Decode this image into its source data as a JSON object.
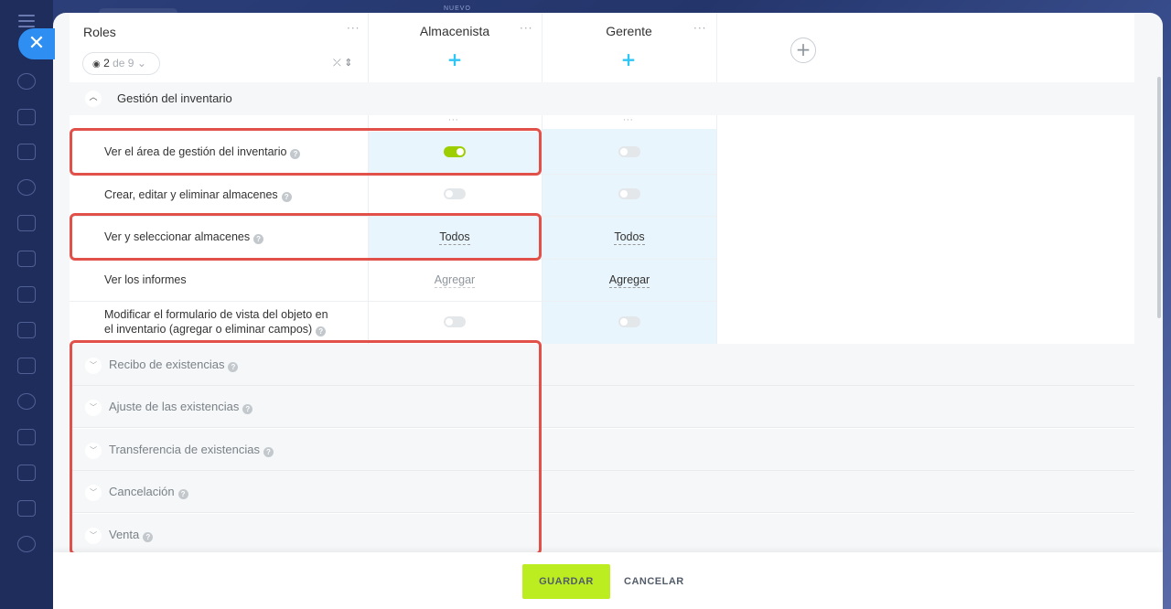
{
  "top": {
    "new_label": "NUEVO"
  },
  "header": {
    "roles_title": "Roles",
    "filter": {
      "shown": "2",
      "of_label": "de 9"
    },
    "columns": [
      {
        "title": "Almacenista"
      },
      {
        "title": "Gerente"
      }
    ]
  },
  "section": {
    "title": "Gestión del inventario"
  },
  "rows": [
    {
      "label": "Ver el área de gestión del inventario",
      "almacenista": "on",
      "gerente": "off"
    },
    {
      "label": "Crear, editar y eliminar almacenes",
      "almacenista": "off",
      "gerente": "off"
    },
    {
      "label": "Ver y seleccionar almacenes",
      "almacenista": "Todos",
      "gerente": "Todos"
    },
    {
      "label": "Ver los informes",
      "almacenista": "Agregar",
      "gerente": "Agregar"
    },
    {
      "label_line1": "Modificar el formulario de vista del objeto en",
      "label_line2": "el inventario (agregar o eliminar campos)",
      "almacenista": "off",
      "gerente": "off"
    }
  ],
  "collapsed_sections": [
    {
      "title": "Recibo de existencias"
    },
    {
      "title": "Ajuste de las existencias"
    },
    {
      "title": "Transferencia de existencias"
    },
    {
      "title": "Cancelación"
    },
    {
      "title": "Venta"
    }
  ],
  "footer": {
    "save_label": "GUARDAR",
    "cancel_label": "CANCELAR"
  },
  "colors": {
    "accent_blue": "#2fc6f6",
    "toggle_on": "#9dcf00",
    "save_button": "#bbed21",
    "highlight_box": "#e2504a",
    "column_highlight": "#e9f5fc"
  }
}
